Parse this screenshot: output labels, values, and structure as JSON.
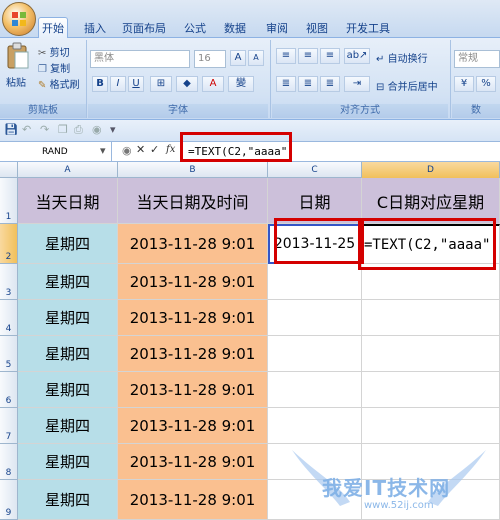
{
  "ribbon": {
    "tabs": [
      "开始",
      "插入",
      "页面布局",
      "公式",
      "数据",
      "审阅",
      "视图",
      "开发工具"
    ],
    "active_tab": "开始",
    "clipboard": {
      "paste": "粘贴",
      "cut": "剪切",
      "copy": "复制",
      "format_painter": "格式刷",
      "label": "剪贴板"
    },
    "font": {
      "name": "黑体",
      "size": "16",
      "label": "字体",
      "bold": "B",
      "italic": "I",
      "underline": "U"
    },
    "alignment": {
      "wrap": "自动换行",
      "merge": "合并后居中",
      "label": "对齐方式"
    },
    "number": {
      "format": "常规",
      "label": "数"
    }
  },
  "formula_bar": {
    "name_box": "RAND",
    "fx": "fx",
    "content": "=TEXT(C2,\"aaaa\")"
  },
  "sheet": {
    "columns": [
      "A",
      "B",
      "C",
      "D"
    ],
    "rows": [
      "1",
      "2",
      "3",
      "4",
      "5",
      "6",
      "7",
      "8",
      "9"
    ],
    "headers": [
      "当天日期",
      "当天日期及时间",
      "日期",
      "C日期对应星期"
    ],
    "c2": "2013-11-25",
    "d2": "=TEXT(C2,\"aaaa\"",
    "data_rows": [
      {
        "a": "星期四",
        "b": "2013-11-28  9:01"
      },
      {
        "a": "星期四",
        "b": "2013-11-28  9:01"
      },
      {
        "a": "星期四",
        "b": "2013-11-28  9:01"
      },
      {
        "a": "星期四",
        "b": "2013-11-28  9:01"
      },
      {
        "a": "星期四",
        "b": "2013-11-28  9:01"
      },
      {
        "a": "星期四",
        "b": "2013-11-28  9:01"
      },
      {
        "a": "星期四",
        "b": "2013-11-28  9:01"
      },
      {
        "a": "星期四",
        "b": "2013-11-28  9:01"
      }
    ]
  },
  "watermark": {
    "text": "我爱IT技术网",
    "url": "www.52ij.com"
  }
}
